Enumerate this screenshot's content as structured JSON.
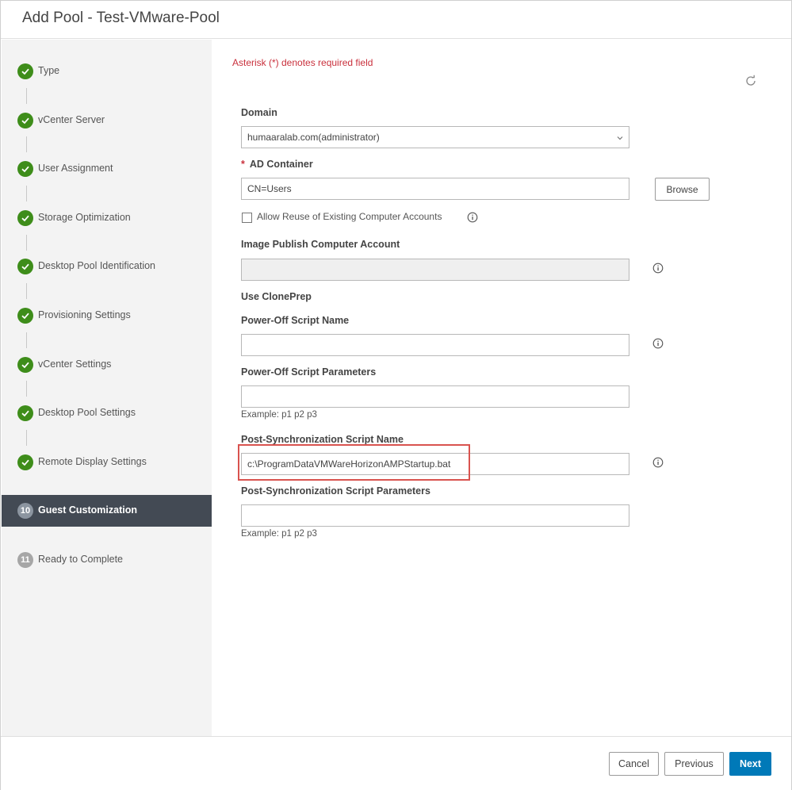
{
  "dialog": {
    "title": "Add Pool - Test-VMware-Pool"
  },
  "sidebar": {
    "steps": [
      {
        "number": "1",
        "label": "Type",
        "status": "done"
      },
      {
        "number": "2",
        "label": "vCenter Server",
        "status": "done"
      },
      {
        "number": "3",
        "label": "User Assignment",
        "status": "done"
      },
      {
        "number": "4",
        "label": "Storage Optimization",
        "status": "done"
      },
      {
        "number": "5",
        "label": "Desktop Pool Identification",
        "status": "done"
      },
      {
        "number": "6",
        "label": "Provisioning Settings",
        "status": "done"
      },
      {
        "number": "7",
        "label": "vCenter Settings",
        "status": "done"
      },
      {
        "number": "8",
        "label": "Desktop Pool Settings",
        "status": "done"
      },
      {
        "number": "9",
        "label": "Remote Display Settings",
        "status": "done"
      },
      {
        "number": "10",
        "label": "Guest Customization",
        "status": "current"
      },
      {
        "number": "11",
        "label": "Ready to Complete",
        "status": "pending"
      }
    ]
  },
  "form": {
    "required_note": "Asterisk (*) denotes required field",
    "domain": {
      "label": "Domain",
      "value": "humaaralab.com(administrator)"
    },
    "ad_container": {
      "required_mark": "*",
      "label": "AD Container",
      "value": "CN=Users",
      "browse_label": "Browse"
    },
    "allow_reuse": {
      "label": "Allow Reuse of Existing Computer Accounts",
      "checked": false
    },
    "image_publish": {
      "label": "Image Publish Computer Account",
      "value": ""
    },
    "use_cloneprep": {
      "label": "Use ClonePrep"
    },
    "power_off_script_name": {
      "label": "Power-Off Script Name",
      "value": ""
    },
    "power_off_script_params": {
      "label": "Power-Off Script Parameters",
      "value": "",
      "example": "Example: p1 p2 p3"
    },
    "post_sync_script_name": {
      "label": "Post-Synchronization Script Name",
      "value": "c:\\ProgramDataVMWareHorizonAMPStartup.bat"
    },
    "post_sync_script_params": {
      "label": "Post-Synchronization Script Parameters",
      "value": "",
      "example": "Example: p1 p2 p3"
    }
  },
  "footer": {
    "cancel_label": "Cancel",
    "previous_label": "Previous",
    "next_label": "Next"
  },
  "colors": {
    "done": "#3e8d1a",
    "active_bg": "#434a54",
    "primary": "#0079b8",
    "required": "#c9303c"
  }
}
